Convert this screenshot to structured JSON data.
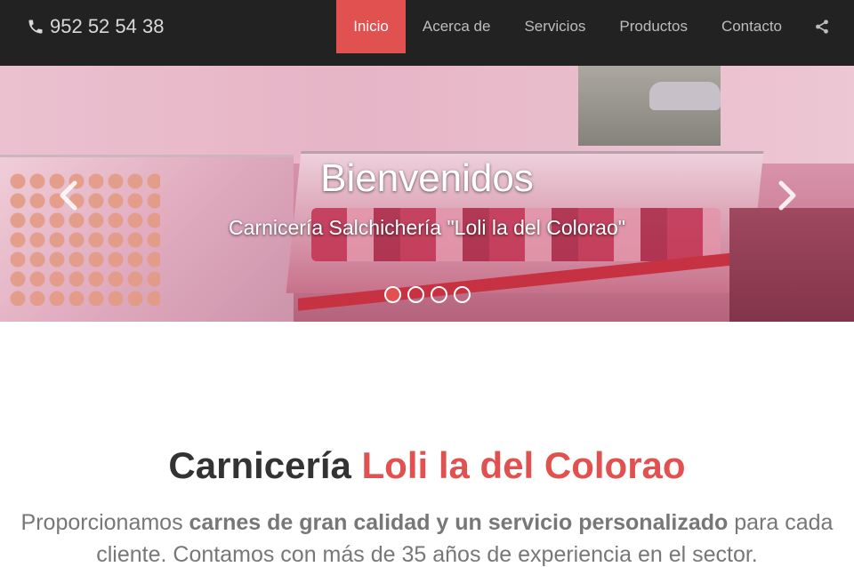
{
  "header": {
    "phone": "952 52 54 38",
    "phone_icon": "phone-icon",
    "nav": [
      {
        "label": "Inicio",
        "active": true
      },
      {
        "label": "Acerca de",
        "active": false
      },
      {
        "label": "Servicios",
        "active": false
      },
      {
        "label": "Productos",
        "active": false
      },
      {
        "label": "Contacto",
        "active": false
      }
    ],
    "share_icon": "share-icon"
  },
  "hero": {
    "title": "Bienvenidos",
    "subtitle": "Carnicería Salchichería \"Loli la del Colorao\"",
    "slide_count": 4,
    "active_slide": 1,
    "prev_icon": "chevron-left-icon",
    "next_icon": "chevron-right-icon"
  },
  "intro": {
    "title_prefix": "Carnicería ",
    "title_accent": "Loli la del Colorao",
    "text_part1": "Proporcionamos ",
    "text_bold": "carnes de gran calidad y un servicio personalizado",
    "text_part2": " para cada cliente. Contamos con más de 35 años de experiencia en el sector."
  },
  "colors": {
    "accent": "#e0514f",
    "navbar_bg": "#222222",
    "nav_text": "#bdbdbd"
  }
}
